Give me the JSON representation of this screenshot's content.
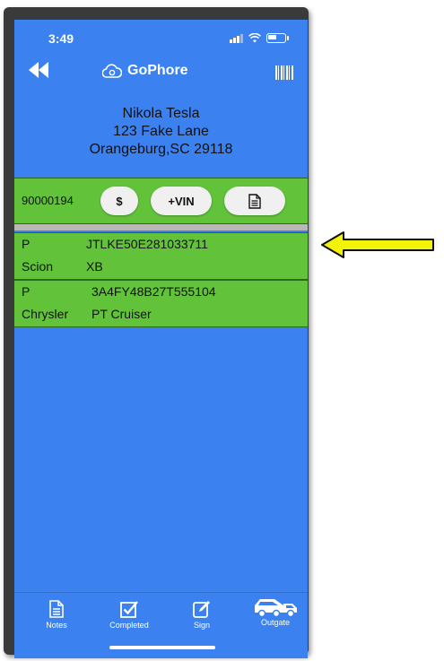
{
  "status_bar": {
    "time": "3:49"
  },
  "nav": {
    "app_name": "GoPhore"
  },
  "customer": {
    "name": "Nikola Tesla",
    "street": "123 Fake Lane",
    "city_state_zip": "Orangeburg,SC 29118"
  },
  "action_bar": {
    "stock_number": "90000194",
    "price_label": "$",
    "vin_label": "+VIN"
  },
  "vehicles": [
    {
      "flag": "P",
      "vin": "JTLKE50E281033711",
      "make": "Scion",
      "model": "XB"
    },
    {
      "flag": "P",
      "vin": "3A4FY48B27T555104",
      "make": "Chrysler",
      "model": "PT Cruiser"
    }
  ],
  "tabbar": {
    "notes": "Notes",
    "completed": "Completed",
    "sign": "Sign",
    "outgate": "Outgate"
  },
  "colors": {
    "screen_bg": "#3b82f0",
    "row_green": "#62c33a",
    "arrow_yellow": "#f2f20a"
  }
}
